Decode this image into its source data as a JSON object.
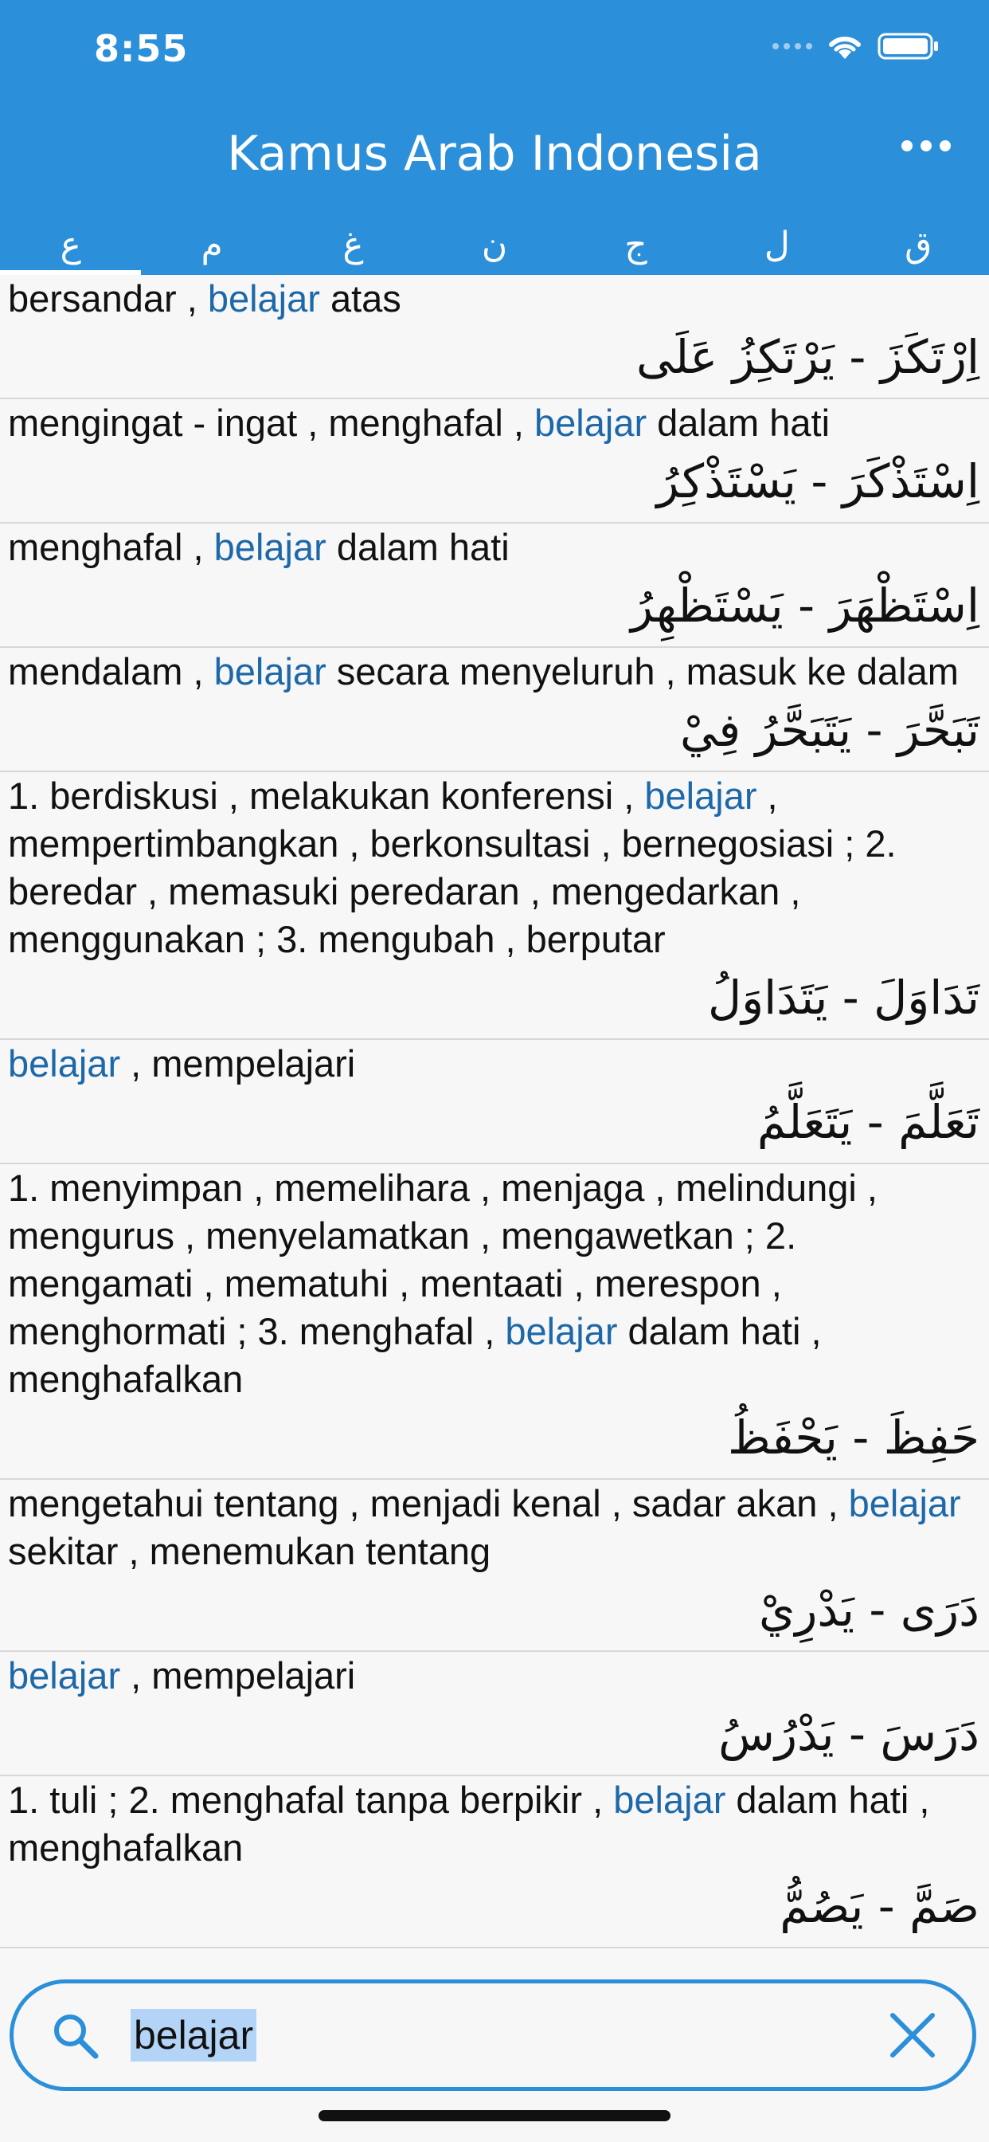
{
  "status": {
    "time": "8:55"
  },
  "header": {
    "title": "Kamus Arab Indonesia",
    "more_icon": "more-horizontal-icon"
  },
  "tabs": [
    "ع",
    "م",
    "غ",
    "ن",
    "ج",
    "ل",
    "ق"
  ],
  "entries": [
    {
      "pre": "bersandar , ",
      "hl": "belajar",
      "post": " atas",
      "arabic": "اِرْتَكَزَ - يَرْتَكِزُ عَلَى"
    },
    {
      "pre": "mengingat - ingat , menghafal , ",
      "hl": "belajar",
      "post": " dalam hati",
      "arabic": "اِسْتَذْكَرَ - يَسْتَذْكِرُ"
    },
    {
      "pre": "menghafal , ",
      "hl": "belajar",
      "post": " dalam hati",
      "arabic": "اِسْتَظْهَرَ - يَسْتَظْهِرُ"
    },
    {
      "pre": "mendalam , ",
      "hl": "belajar",
      "post": " secara menyeluruh , masuk ke dalam",
      "arabic": "تَبَحَّرَ - يَتَبَحَّرُ فِيْ"
    },
    {
      "pre": "1. berdiskusi , melakukan konferensi , ",
      "hl": "belajar",
      "post": " , mempertimbangkan , berkonsultasi , bernegosiasi ; 2. beredar , memasuki peredaran , mengedarkan , menggunakan ; 3. mengubah , berputar",
      "arabic": "تَدَاوَلَ - يَتَدَاوَلُ"
    },
    {
      "pre": "",
      "hl": "belajar",
      "post": " , mempelajari",
      "arabic": "تَعَلَّمَ - يَتَعَلَّمُ"
    },
    {
      "pre": "1. menyimpan , memelihara , menjaga , melindungi , mengurus , menyelamatkan , mengawetkan ; 2. mengamati , mematuhi , mentaati , merespon , menghormati ; 3. menghafal , ",
      "hl": "belajar",
      "post": " dalam hati , menghafalkan",
      "arabic": "حَفِظَ - يَحْفَظُ"
    },
    {
      "pre": "mengetahui tentang , menjadi kenal , sadar akan , ",
      "hl": "belajar",
      "post": " sekitar , menemukan tentang",
      "arabic": "دَرَى - يَدْرِيْ"
    },
    {
      "pre": "",
      "hl": "belajar",
      "post": " , mempelajari",
      "arabic": "دَرَسَ - يَدْرُسُ"
    },
    {
      "pre": "1. tuli ; 2. menghafal tanpa berpikir , ",
      "hl": "belajar",
      "post": " dalam hati , menghafalkan",
      "arabic": "صَمَّ - يَصُمُّ"
    }
  ],
  "search": {
    "value": "belajar",
    "search_icon": "search-icon",
    "clear_icon": "close-icon"
  },
  "colors": {
    "header": "#2b8fd9",
    "highlight": "#1d68a8"
  }
}
